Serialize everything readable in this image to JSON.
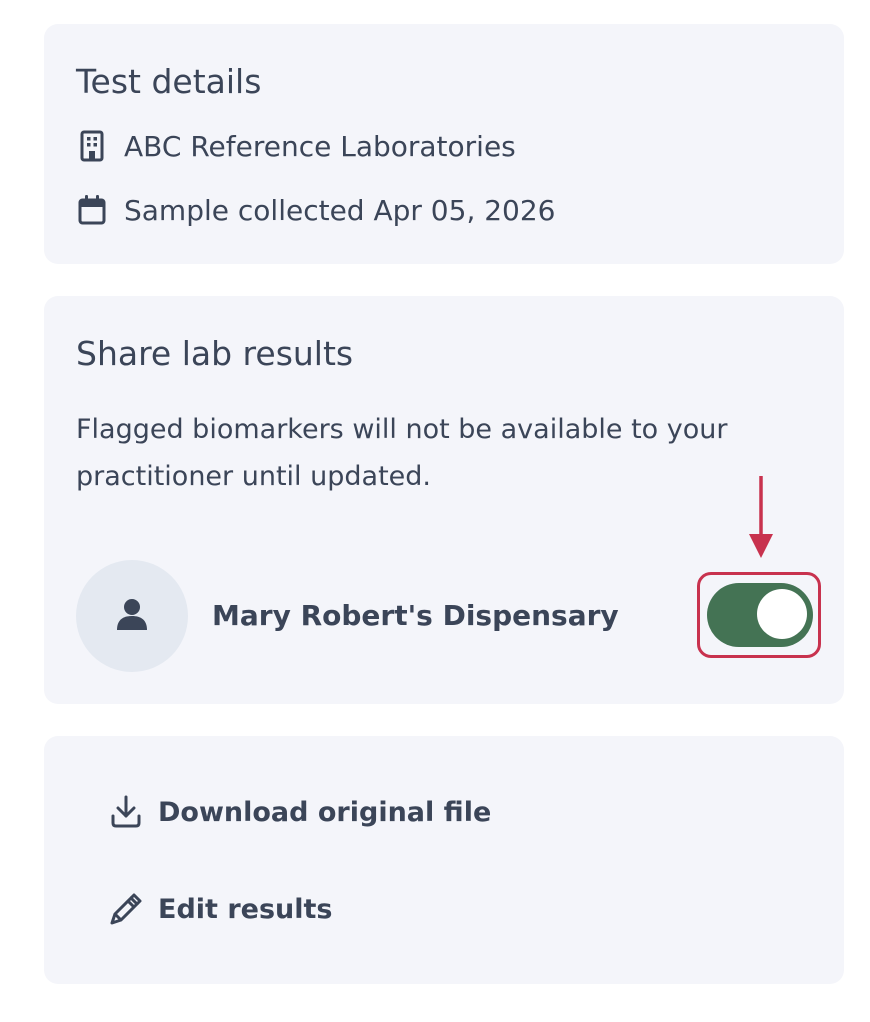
{
  "test_details": {
    "title": "Test details",
    "lab_name": "ABC Reference Laboratories",
    "lab_icon": "building-icon",
    "sample_collected": "Sample collected Apr 05, 2026",
    "sample_icon": "calendar-icon"
  },
  "share": {
    "title": "Share lab results",
    "description": "Flagged biomarkers will not be available to your practitioner until updated.",
    "practitioner": {
      "name": "Mary Robert's Dispensary",
      "avatar_icon": "user-icon",
      "sharing_enabled": true
    }
  },
  "actions": {
    "download_label": "Download original file",
    "download_icon": "download-icon",
    "edit_label": "Edit results",
    "edit_icon": "pencil-icon"
  },
  "colors": {
    "card_background": "#f4f5fa",
    "text": "#3b4558",
    "toggle_on": "#447354",
    "annotation": "#c8324e",
    "avatar_background": "#e4e9f1"
  }
}
